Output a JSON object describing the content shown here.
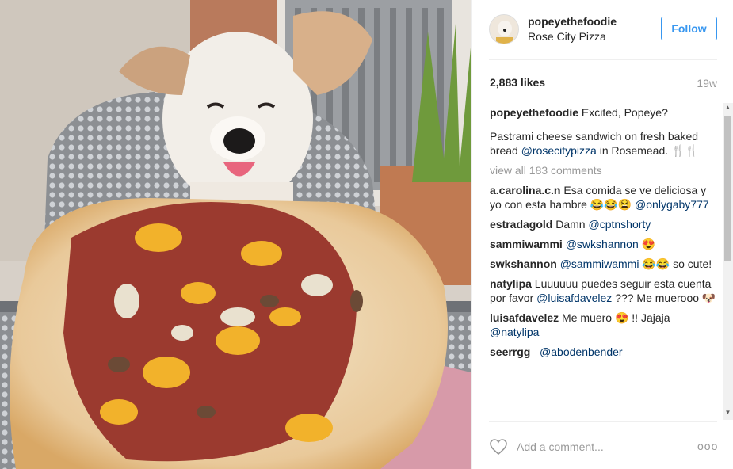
{
  "post": {
    "username": "popeyethefoodie",
    "location": "Rose City Pizza",
    "follow_label": "Follow",
    "likes": "2,883 likes",
    "time_ago": "19w",
    "caption_user": "popeyethefoodie",
    "caption_text": "Excited, Popeye?",
    "caption_body_1": "Pastrami cheese sandwich on fresh baked bread",
    "caption_mention": "@rosecitypizza",
    "caption_body_2": "in Rosemead. 🍴🍴",
    "view_all": "view all 183 comments",
    "add_comment_placeholder": "Add a comment...",
    "more_label": "ooo"
  },
  "comments": [
    {
      "user": "a.carolina.c.n",
      "text": "Esa comida se ve deliciosa y yo con esta hambre 😂😂😫",
      "mention": "@onlygaby777"
    },
    {
      "user": "estradagold",
      "text": "Damn",
      "mention": "@cptnshorty"
    },
    {
      "user": "sammiwammi",
      "text": "",
      "mention": "@swkshannon 😍"
    },
    {
      "user": "swkshannon",
      "text": "",
      "mention": "@sammiwammi",
      "tail": "😂😂 so cute!"
    },
    {
      "user": "natylipa",
      "text": "Luuuuuu puedes seguir esta cuenta por favor",
      "mention": "@luisafdavelez",
      "tail": "??? Me muerooo 🐶"
    },
    {
      "user": "luisafdavelez",
      "text": "Me muero 😍 !! Jajaja",
      "mention": "@natylipa"
    },
    {
      "user": "seerrgg_",
      "text": "",
      "mention": "@abodenbender"
    }
  ],
  "icons": {
    "heart": "heart-icon",
    "scroll_up": "scroll-up-arrow-icon",
    "scroll_down": "scroll-down-arrow-icon"
  },
  "colors": {
    "accent": "#3897f0",
    "mention": "#003569",
    "muted": "#999999"
  }
}
